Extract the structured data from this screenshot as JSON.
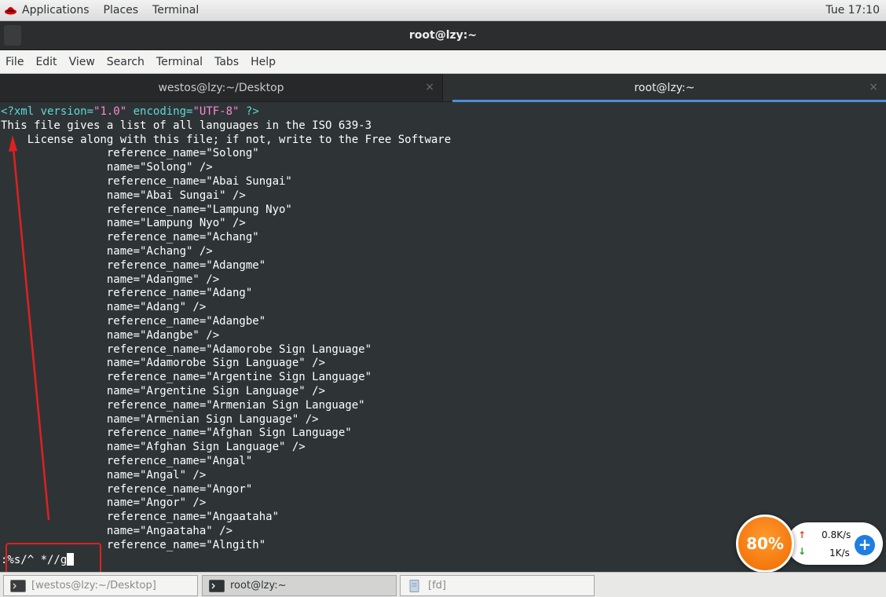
{
  "topbar": {
    "applications": "Applications",
    "places": "Places",
    "terminal": "Terminal",
    "clock": "Tue 17:10"
  },
  "window": {
    "title": "root@lzy:~"
  },
  "menubar": [
    "File",
    "Edit",
    "View",
    "Search",
    "Terminal",
    "Tabs",
    "Help"
  ],
  "tabs": [
    {
      "label": "westos@lzy:~/Desktop",
      "active": false,
      "close": "×"
    },
    {
      "label": "root@lzy:~",
      "active": true,
      "close": "×"
    }
  ],
  "terminal": {
    "xml_decl_prefix": "<?xml version=",
    "xml_version": "\"1.0\"",
    "xml_encoding_attr": " encoding=",
    "xml_encoding": "\"UTF-8\"",
    "xml_decl_suffix": " ?>",
    "lines": [
      "This file gives a list of all languages in the ISO 639-3",
      "    License along with this file; if not, write to the Free Software",
      "                reference_name=\"Solong\"",
      "                name=\"Solong\" />",
      "                reference_name=\"Abai Sungai\"",
      "                name=\"Abai Sungai\" />",
      "                reference_name=\"Lampung Nyo\"",
      "                name=\"Lampung Nyo\" />",
      "                reference_name=\"Achang\"",
      "                name=\"Achang\" />",
      "                reference_name=\"Adangme\"",
      "                name=\"Adangme\" />",
      "                reference_name=\"Adang\"",
      "                name=\"Adang\" />",
      "                reference_name=\"Adangbe\"",
      "                name=\"Adangbe\" />",
      "                reference_name=\"Adamorobe Sign Language\"",
      "                name=\"Adamorobe Sign Language\" />",
      "                reference_name=\"Argentine Sign Language\"",
      "                name=\"Argentine Sign Language\" />",
      "                reference_name=\"Armenian Sign Language\"",
      "                name=\"Armenian Sign Language\" />",
      "                reference_name=\"Afghan Sign Language\"",
      "                name=\"Afghan Sign Language\" />",
      "                reference_name=\"Angal\"",
      "                name=\"Angal\" />",
      "                reference_name=\"Angor\"",
      "                name=\"Angor\" />",
      "                reference_name=\"Angaataha\"",
      "                name=\"Angaataha\" />",
      "                reference_name=\"Alngith\""
    ],
    "command": ":%s/^ *//g"
  },
  "taskbar": [
    {
      "label": "[westos@lzy:~/Desktop]",
      "icon": "terminal-icon",
      "active": false
    },
    {
      "label": "root@lzy:~",
      "icon": "terminal-icon",
      "active": true
    },
    {
      "label": "[fd]",
      "icon": "file-icon",
      "active": false
    }
  ],
  "net_widget": {
    "percent": "80%",
    "upload": "0.8K/s",
    "download": "1K/s",
    "upload_arrow": "↑",
    "download_arrow": "↓",
    "plus": "+"
  },
  "colors": {
    "terminal_bg": "#2e3436",
    "tab_indicator": "#4a90d9",
    "annotation_red": "#e02020",
    "widget_orange": "#f06a00"
  }
}
